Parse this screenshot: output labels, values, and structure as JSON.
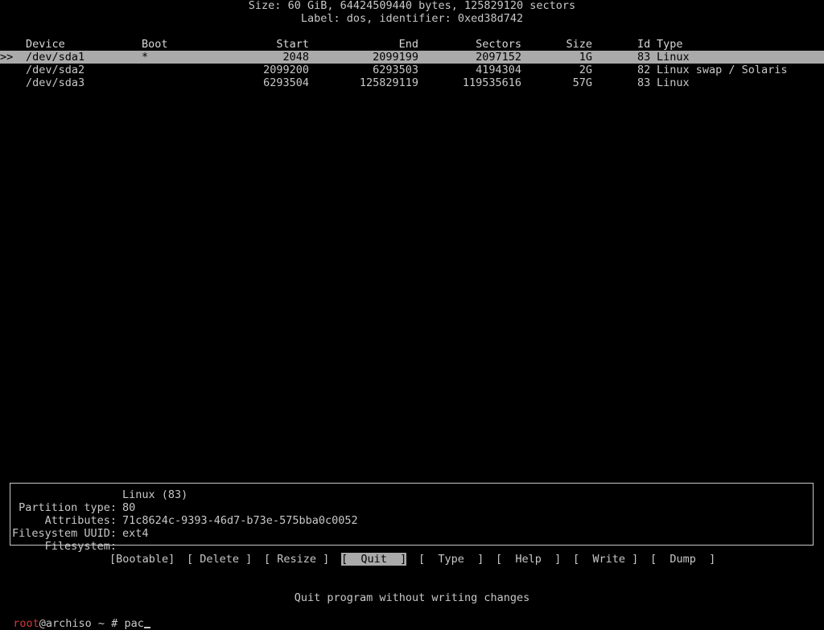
{
  "disk": {
    "size_line": "Size: 60 GiB, 64424509440 bytes, 125829120 sectors",
    "label_line": "Label: dos, identifier: 0xed38d742"
  },
  "columns": {
    "device": "Device",
    "boot": "Boot",
    "start": "Start",
    "end": "End",
    "sectors": "Sectors",
    "size": "Size",
    "id": "Id",
    "type": "Type"
  },
  "partitions": [
    {
      "marker": ">>",
      "device": "/dev/sda1",
      "boot": "*",
      "start": "2048",
      "end": "2099199",
      "sectors": "2097152",
      "size": "1G",
      "id": "83",
      "type": "Linux"
    },
    {
      "marker": "",
      "device": "/dev/sda2",
      "boot": "",
      "start": "2099200",
      "end": "6293503",
      "sectors": "4194304",
      "size": "2G",
      "id": "82",
      "type": "Linux swap / Solaris"
    },
    {
      "marker": "",
      "device": "/dev/sda3",
      "boot": "",
      "start": "6293504",
      "end": "125829119",
      "sectors": "119535616",
      "size": "57G",
      "id": "83",
      "type": "Linux"
    }
  ],
  "info": {
    "partition_type_label": "Partition type:",
    "partition_type_value": "Linux (83)",
    "attributes_label": "Attributes:",
    "attributes_value": "80",
    "uuid_label": "Filesystem UUID:",
    "uuid_value": "71c8624c-9393-46d7-b73e-575bba0c0052",
    "filesystem_label": "Filesystem:",
    "filesystem_value": "ext4"
  },
  "menu": {
    "bootable": "[Bootable]",
    "delete": "[ Delete ]",
    "resize": "[ Resize ]",
    "quit": "[  Quit  ]",
    "type": "[  Type  ]",
    "help": "[  Help  ]",
    "write": "[  Write ]",
    "dump": "[  Dump  ]"
  },
  "status_message": "Quit program without writing changes",
  "prompt": {
    "user": "root",
    "rest": "@archiso ~ # pac"
  }
}
